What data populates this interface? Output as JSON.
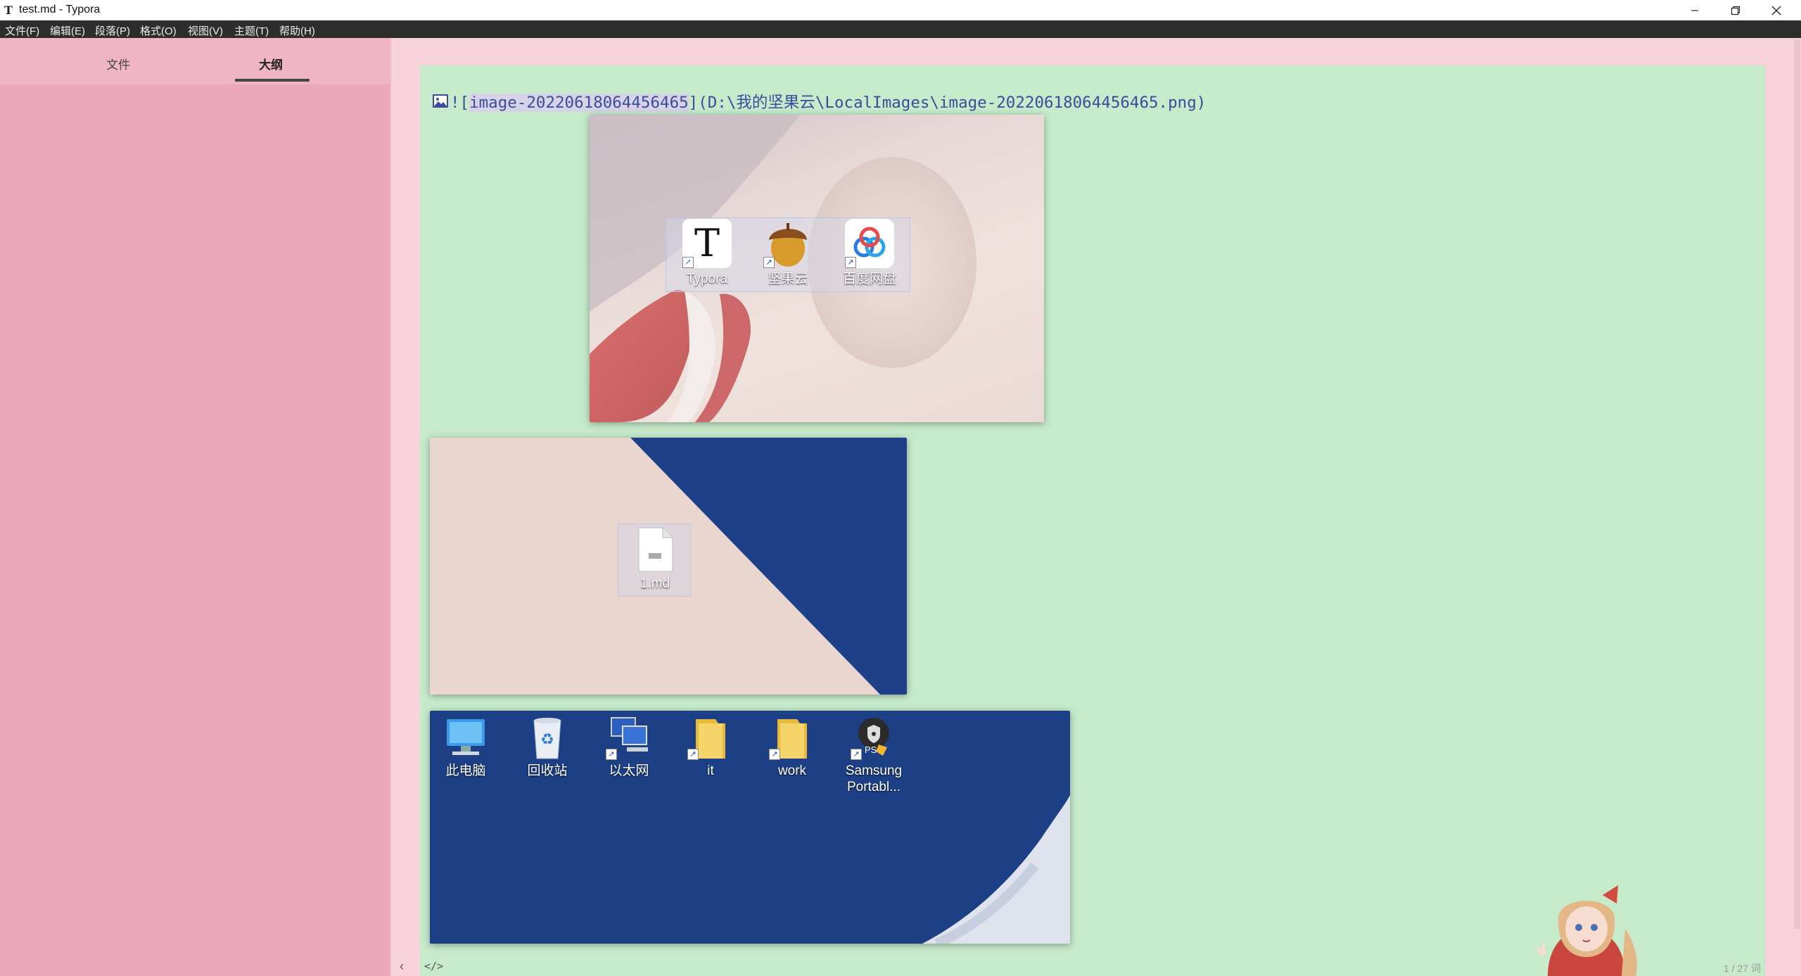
{
  "window": {
    "title": "test.md - Typora",
    "app_icon": "T",
    "buttons": [
      "minimize-icon",
      "restore-icon",
      "close-icon"
    ]
  },
  "menu": {
    "items": [
      "文件(F)",
      "编辑(E)",
      "段落(P)",
      "格式(O)",
      "视图(V)",
      "主题(T)",
      "帮助(H)"
    ]
  },
  "sidebar": {
    "tabs": [
      "文件",
      "大纲"
    ],
    "active_tab": "大纲"
  },
  "editor": {
    "image_markdown": {
      "prefix": "![",
      "alt": "image-20220618064456465",
      "middle": "](",
      "path": "D:\\我的坚果云\\LocalImages\\image-20220618064456465.png",
      "suffix": ")"
    },
    "shot1_icons": [
      "Typora",
      "坚果云",
      "百度网盘"
    ],
    "shot2_icons": [
      "1.md"
    ],
    "shot3_icons": [
      "此电脑",
      "回收站",
      "以太网",
      "it",
      "work",
      "Samsung Portabl..."
    ]
  },
  "footer": {
    "sidebar_toggle": "‹",
    "source_toggle": "</>",
    "word_count": "1 / 27 词"
  },
  "colors": {
    "sidebar": "#eba8ba",
    "page": "#c7eacb",
    "menubar": "#2d2d2d",
    "link": "#3b4c9c"
  }
}
